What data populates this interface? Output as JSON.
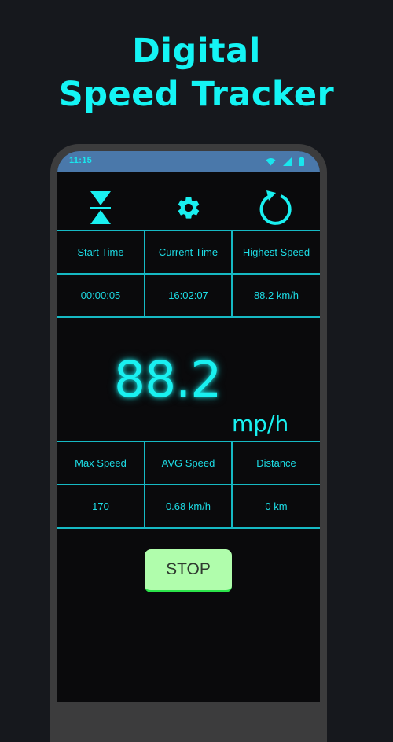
{
  "headline": {
    "line1": "Digital",
    "line2": "Speed Tracker"
  },
  "status_bar": {
    "time": "11:15",
    "icons": [
      "wifi-icon",
      "signal-icon",
      "battery-icon"
    ]
  },
  "toolbar": {
    "icons": [
      "vertical-align-center-icon",
      "gear-icon",
      "refresh-icon"
    ]
  },
  "top_table": {
    "headers": [
      "Start Time",
      "Current Time",
      "Highest Speed"
    ],
    "values": [
      "00:00:05",
      "16:02:07",
      "88.2 km/h"
    ]
  },
  "speedometer": {
    "value": "88.2",
    "unit": "mp/h"
  },
  "bottom_table": {
    "headers": [
      "Max Speed",
      "AVG Speed",
      "Distance"
    ],
    "values": [
      "170",
      "0.68 km/h",
      "0 km"
    ]
  },
  "stop_button": {
    "label": "STOP"
  },
  "colors": {
    "accent": "#19f0f0",
    "grid": "#16b9c4",
    "status_bar": "#4a78aa",
    "stop_bg": "#b0fdac"
  }
}
